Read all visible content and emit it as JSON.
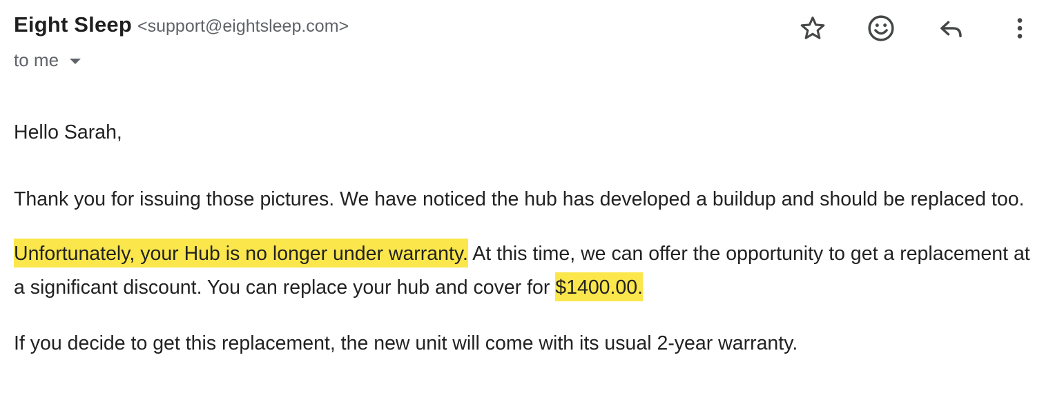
{
  "email": {
    "sender_name": "Eight Sleep",
    "sender_email": "<support@eightsleep.com>",
    "recipient_label": "to me"
  },
  "actions": {
    "star_icon": "star-icon",
    "emoji_icon": "emoji-icon",
    "reply_icon": "reply-icon",
    "more_icon": "more-vert-icon"
  },
  "body": {
    "greeting": "Hello Sarah,",
    "paragraph1": "Thank you for issuing those pictures. We have noticed the hub has developed a buildup and should be replaced too.",
    "paragraph2_highlight": "Unfortunately, your Hub is no longer under warranty.",
    "paragraph2_text": " At this time, we can offer the opportunity to get a replacement at a significant discount. You can replace your hub and cover for ",
    "paragraph2_price": "$1400.00.",
    "paragraph3": "If you decide to get this replacement, the new unit will come with its usual 2-year warranty."
  },
  "colors": {
    "highlight": "#fbe74b",
    "secondary_text": "#5f6368",
    "primary_text": "#222222"
  }
}
